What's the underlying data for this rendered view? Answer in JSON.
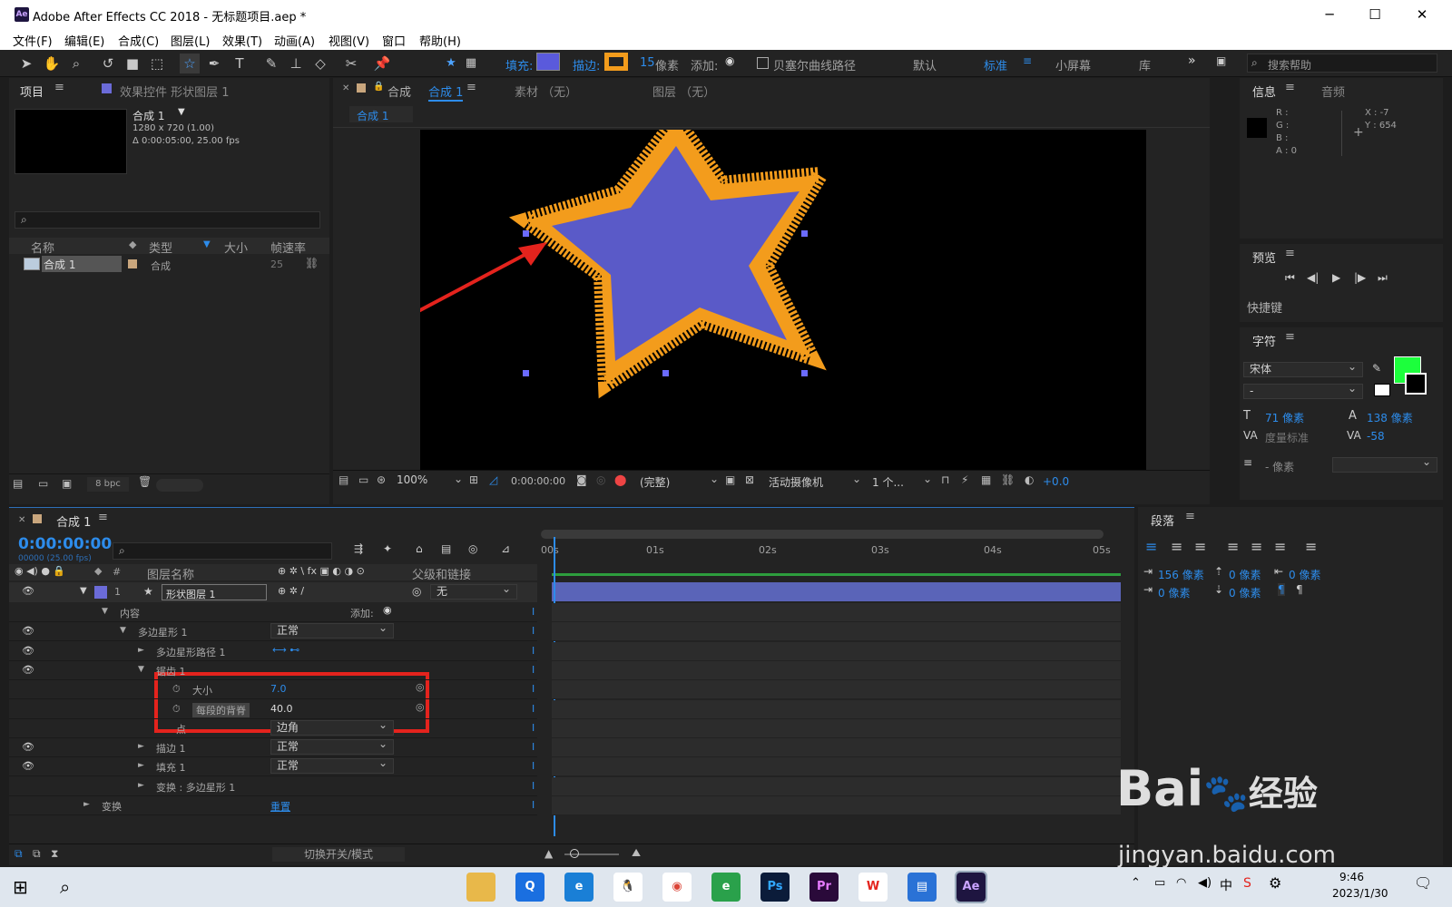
{
  "window": {
    "title": "Adobe After Effects CC 2018 - 无标题项目.aep *",
    "app_icon": "Ae",
    "minimize": "─",
    "maximize": "☐",
    "close": "✕"
  },
  "menu": [
    "文件(F)",
    "编辑(E)",
    "合成(C)",
    "图层(L)",
    "效果(T)",
    "动画(A)",
    "视图(V)",
    "窗口",
    "帮助(H)"
  ],
  "toolbar": {
    "fill_label": "填充:",
    "stroke_label": "描边:",
    "stroke_width": "15",
    "stroke_unit": "像素",
    "add_label": "添加:",
    "bezier_label": "贝塞尔曲线路径",
    "workspaces": [
      "默认",
      "标准",
      "小屏幕",
      "库"
    ],
    "search_placeholder": "搜索帮助",
    "fill_color": "#5a5adc",
    "stroke_color": "#f39c1c"
  },
  "project": {
    "tab": "项目",
    "tab2": "效果控件 形状图层 1",
    "comp_name": "合成 1",
    "comp_info1": "1280 x 720 (1.00)",
    "comp_info2": "Δ 0:00:05:00, 25.00 fps",
    "cols": [
      "名称",
      "类型",
      "大小",
      "帧速率"
    ],
    "row": {
      "name": "合成 1",
      "type": "合成",
      "fps": "25"
    },
    "bpc": "8 bpc"
  },
  "comp": {
    "tab": "合成",
    "tab_active": "合成 1",
    "footage": "素材 （无）",
    "layer": "图层 （无）",
    "breadcrumb": "合成 1",
    "zoom": "100%",
    "time": "0:00:00:00",
    "quality": "(完整)",
    "camera": "活动摄像机",
    "views": "1 个...",
    "exposure": "+0.0"
  },
  "info": {
    "tab": "信息",
    "tab2": "音频",
    "r": "R :",
    "g": "G :",
    "b": "B :",
    "a": "A : 0",
    "x": "X : -7",
    "y": "Y : 654"
  },
  "preview": {
    "tab": "预览",
    "shortcut": "快捷键"
  },
  "character": {
    "tab": "字符",
    "font": "宋体",
    "style": "-",
    "size": "71 像素",
    "leading": "138 像素",
    "kerning": "度量标准",
    "tracking": "-58",
    "indent": "- 像素",
    "color": "#1cff3c"
  },
  "paragraph": {
    "tab": "段落",
    "v1": "156 像素",
    "v2": "0 像素",
    "v3": "0 像素",
    "v4": "0 像素",
    "v5": "0 像素"
  },
  "timeline": {
    "tab": "合成 1",
    "timecode": "0:00:00:00",
    "frames": "00000 (25.00 fps)",
    "col_name": "图层名称",
    "col_parent": "父级和链接",
    "layer_num": "1",
    "layer_name": "形状图层 1",
    "parent": "无",
    "ruler": [
      "00s",
      "01s",
      "02s",
      "03s",
      "04s",
      "05s"
    ],
    "toggle": "切换开关/模式",
    "rows": [
      {
        "label": "内容",
        "extra": "添加:"
      },
      {
        "label": "多边星形 1",
        "dd": "正常"
      },
      {
        "label": "多边星形路径 1"
      },
      {
        "label": "锯齿 1"
      },
      {
        "label": "大小",
        "value": "7.0"
      },
      {
        "label": "每段的背脊",
        "value": "40.0"
      },
      {
        "label": "点",
        "dd": "边角"
      },
      {
        "label": "描边 1",
        "dd": "正常"
      },
      {
        "label": "填充 1",
        "dd": "正常"
      },
      {
        "label": "变换 : 多边星形 1"
      },
      {
        "label": "变换",
        "link": "重置"
      }
    ]
  },
  "taskbar": {
    "time": "9:46",
    "date": "2023/1/30",
    "ime": "中",
    "apps": [
      "Ps",
      "Pr",
      "Ae"
    ]
  },
  "watermark": {
    "brand": "Bai",
    "brand2": "经验",
    "url": "jingyan.baidu.com"
  }
}
